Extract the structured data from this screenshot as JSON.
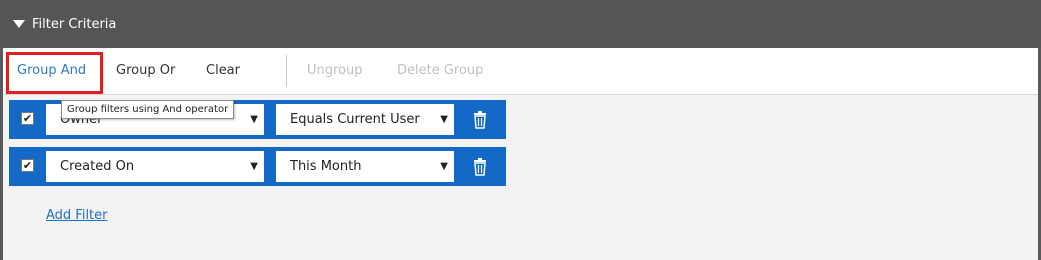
{
  "header": {
    "title": "Filter Criteria"
  },
  "toolbar": {
    "group_and": "Group And",
    "group_or": "Group Or",
    "clear": "Clear",
    "ungroup": "Ungroup",
    "delete_group": "Delete Group"
  },
  "tooltip": "Group filters using And operator",
  "filters": [
    {
      "checked": true,
      "field": "Owner",
      "operator": "Equals Current User"
    },
    {
      "checked": true,
      "field": "Created On",
      "operator": "This Month"
    }
  ],
  "add_filter": "Add Filter",
  "colors": {
    "header_bg": "#555555",
    "row_bg": "#1469c7",
    "active_link": "#2f7ac6",
    "highlight": "#e02020"
  },
  "icons": {
    "collapse": "triangle-down-icon",
    "checkbox": "check-icon",
    "dropdown": "chevron-down-icon",
    "delete": "trash-icon"
  }
}
